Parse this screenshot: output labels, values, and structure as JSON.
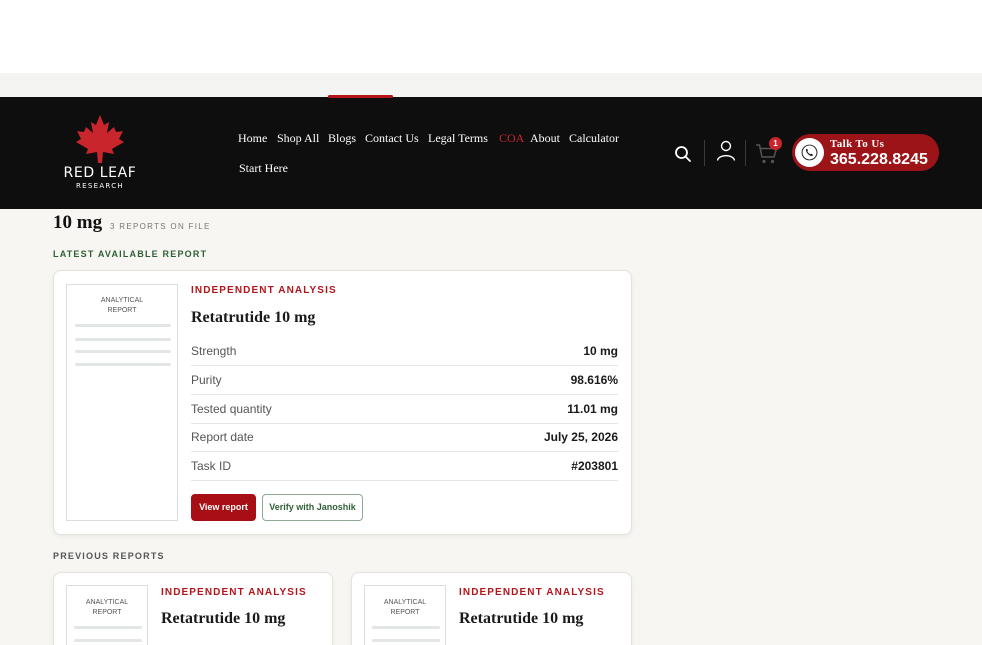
{
  "brand": {
    "name": "RED LEAF",
    "tagline": "RESEARCH",
    "accent": "#b3151b"
  },
  "nav": {
    "items": [
      {
        "label": "Home",
        "active": false
      },
      {
        "label": "Shop All",
        "active": false
      },
      {
        "label": "Blogs",
        "active": false
      },
      {
        "label": "Contact Us",
        "active": false
      },
      {
        "label": "Legal Terms",
        "active": false
      },
      {
        "label": "COA",
        "active": true
      },
      {
        "label": "About",
        "active": false
      },
      {
        "label": "Calculator",
        "active": false
      },
      {
        "label": "Start Here",
        "active": false
      }
    ]
  },
  "header_icons": {
    "search": "search-icon",
    "account": "user-icon",
    "cart": "cart-icon",
    "cart_count": "1"
  },
  "contact": {
    "label": "Talk To Us",
    "phone": "365.228.8245",
    "icon": "phone-icon"
  },
  "page": {
    "strength_title": "10 mg",
    "reports_count": "3 REPORTS ON FILE",
    "latest_label": "LATEST AVAILABLE REPORT",
    "previous_label": "PREVIOUS REPORTS"
  },
  "latest_report": {
    "thumb_line1": "ANALYTICAL",
    "thumb_line2": "REPORT",
    "eyebrow": "INDEPENDENT ANALYSIS",
    "title": "Retatrutide 10 mg",
    "specs": [
      {
        "label": "Strength",
        "value": "10 mg"
      },
      {
        "label": "Purity",
        "value": "98.616%"
      },
      {
        "label": "Tested quantity",
        "value": "11.01 mg"
      },
      {
        "label": "Report date",
        "value": "July 25, 2026"
      },
      {
        "label": "Task ID",
        "value": "#203801"
      }
    ],
    "view_label": "View report",
    "verify_label": "Verify with Janoshik"
  },
  "previous_reports": [
    {
      "thumb_line1": "ANALYTICAL",
      "thumb_line2": "REPORT",
      "eyebrow": "INDEPENDENT ANALYSIS",
      "title": "Retatrutide 10 mg"
    },
    {
      "thumb_line1": "ANALYTICAL",
      "thumb_line2": "REPORT",
      "eyebrow": "INDEPENDENT ANALYSIS",
      "title": "Retatrutide 10 mg"
    }
  ]
}
